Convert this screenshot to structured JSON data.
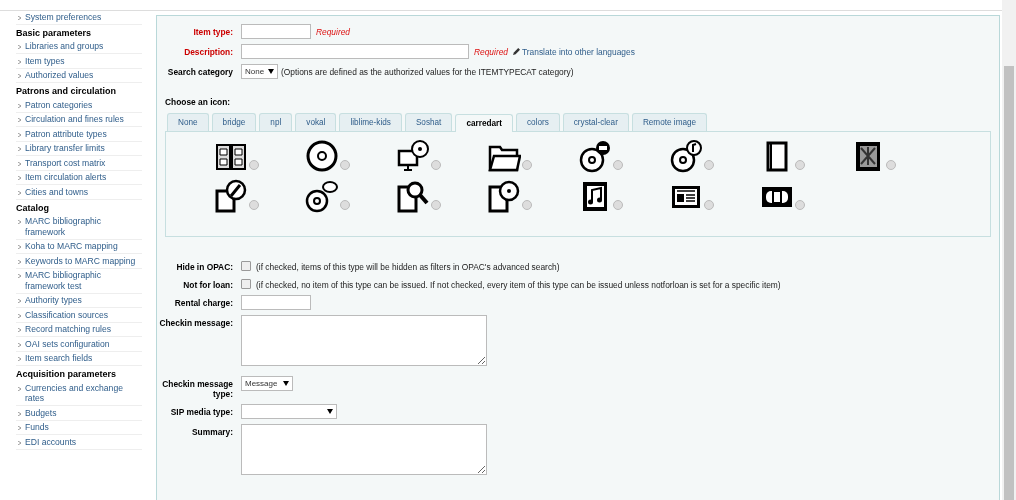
{
  "sidebar": {
    "sections": [
      {
        "items": [
          {
            "label": "System preferences"
          }
        ]
      },
      {
        "heading": "Basic parameters",
        "items": [
          {
            "label": "Libraries and groups"
          },
          {
            "label": "Item types"
          },
          {
            "label": "Authorized values"
          }
        ]
      },
      {
        "heading": "Patrons and circulation",
        "items": [
          {
            "label": "Patron categories"
          },
          {
            "label": "Circulation and fines rules"
          },
          {
            "label": "Patron attribute types"
          },
          {
            "label": "Library transfer limits"
          },
          {
            "label": "Transport cost matrix"
          },
          {
            "label": "Item circulation alerts"
          },
          {
            "label": "Cities and towns"
          }
        ]
      },
      {
        "heading": "Catalog",
        "items": [
          {
            "label": "MARC bibliographic framework"
          },
          {
            "label": "Koha to MARC mapping"
          },
          {
            "label": "Keywords to MARC mapping"
          },
          {
            "label": "MARC bibliographic framework test"
          },
          {
            "label": "Authority types"
          },
          {
            "label": "Classification sources"
          },
          {
            "label": "Record matching rules"
          },
          {
            "label": "OAI sets configuration"
          },
          {
            "label": "Item search fields"
          }
        ]
      },
      {
        "heading": "Acquisition parameters",
        "items": [
          {
            "label": "Currencies and exchange rates"
          },
          {
            "label": "Budgets"
          },
          {
            "label": "Funds"
          },
          {
            "label": "EDI accounts"
          }
        ]
      }
    ]
  },
  "form": {
    "item_type": {
      "label": "Item type:",
      "required": true,
      "note": "Required"
    },
    "description": {
      "label": "Description:",
      "required": true,
      "note": "Required",
      "link": "Translate into other languages"
    },
    "search_category": {
      "label": "Search category",
      "value": "None",
      "hint": "(Options are defined as the authorized values for the ITEMTYPECAT category)"
    },
    "choose_icon": {
      "label": "Choose an icon:",
      "tabs": [
        {
          "label": "None",
          "selected": false
        },
        {
          "label": "bridge",
          "selected": false
        },
        {
          "label": "npl",
          "selected": false
        },
        {
          "label": "vokal",
          "selected": false
        },
        {
          "label": "liblime-kids",
          "selected": false
        },
        {
          "label": "Soshat",
          "selected": false
        },
        {
          "label": "carredart",
          "selected": true
        },
        {
          "label": "colors",
          "selected": false
        },
        {
          "label": "crystal-clear",
          "selected": false
        },
        {
          "label": "Remote image",
          "selected": false
        }
      ],
      "icons": [
        {
          "selected": false
        },
        {
          "selected": false
        },
        {
          "selected": false
        },
        {
          "selected": false
        },
        {
          "selected": false
        },
        {
          "selected": false
        },
        {
          "selected": false
        },
        {
          "selected": false
        },
        {
          "selected": false
        },
        {
          "selected": false
        },
        {
          "selected": false
        },
        {
          "selected": false
        },
        {
          "selected": false
        },
        {
          "selected": false
        },
        {
          "selected": false
        }
      ]
    },
    "hide_in_opac": {
      "label": "Hide in OPAC:",
      "checked": false,
      "hint": "(if checked, items of this type will be hidden as filters in OPAC's advanced search)"
    },
    "not_for_loan": {
      "label": "Not for loan:",
      "checked": false,
      "hint": "(if checked, no item of this type can be issued. If not checked, every item of this type can be issued unless notforloan is set for a specific item)"
    },
    "rental_charge": {
      "label": "Rental charge:"
    },
    "checkin_message": {
      "label": "Checkin message:"
    },
    "checkin_message_type": {
      "label": "Checkin message type:",
      "value": "Message"
    },
    "sip_media_type": {
      "label": "SIP media type:"
    },
    "summary": {
      "label": "Summary:"
    }
  }
}
